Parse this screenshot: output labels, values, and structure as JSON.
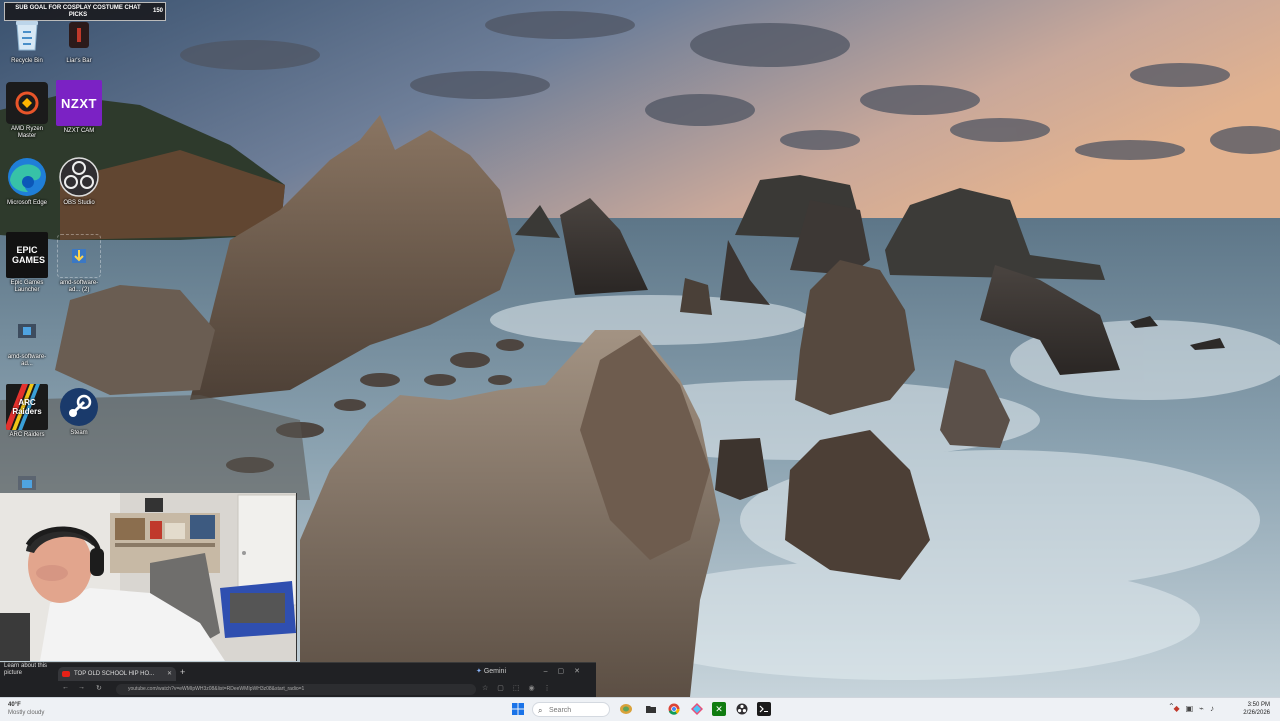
{
  "overlay": {
    "goal_title": "SUB GOAL FOR COSPLAY COSTUME CHAT PICKS",
    "goal_count": "150"
  },
  "desktop": {
    "icons": [
      {
        "label": "Recycle Bin",
        "icon": "recycle-bin-icon"
      },
      {
        "label": "Liar's Bar",
        "icon": "liars-bar-icon"
      },
      {
        "label": "AMD Ryzen Master",
        "icon": "amd-ryzen-master-icon"
      },
      {
        "label": "NZXT CAM",
        "icon": "nzxt-cam-icon",
        "logo_text": "NZXT"
      },
      {
        "label": "Microsoft Edge",
        "icon": "edge-icon"
      },
      {
        "label": "OBS Studio",
        "icon": "obs-icon"
      },
      {
        "label": "Epic Games Launcher",
        "icon": "epic-games-icon",
        "logo_text": "EPIC GAMES"
      },
      {
        "label": "amd-software-ad... (2)",
        "icon": "installer-icon"
      },
      {
        "label": "amd-software-ad...",
        "icon": "installer-icon"
      },
      {
        "label": "ARC Raiders",
        "icon": "arc-raiders-icon",
        "logo_text": "ARC Raiders"
      },
      {
        "label": "Steam",
        "icon": "steam-icon"
      }
    ]
  },
  "browser": {
    "learn_more": "Learn about this picture",
    "tab_title": "TOP OLD SCHOOL HIP HO...",
    "gemini_label": "Gemini",
    "url": "youtube.com/watch?v=eWMIpWH3z08&list=RDeeWMIpWH3z08&start_radio=1"
  },
  "taskbar": {
    "weather_temp": "40°F",
    "weather_cond": "Mostly cloudy",
    "search_placeholder": "Search",
    "time": "3:50 PM",
    "date": "2/26/2026"
  },
  "colors": {
    "taskbar_bg": "#eef1f5",
    "youtube_red": "#e62117",
    "nzxt_purple": "#7b22c4"
  }
}
